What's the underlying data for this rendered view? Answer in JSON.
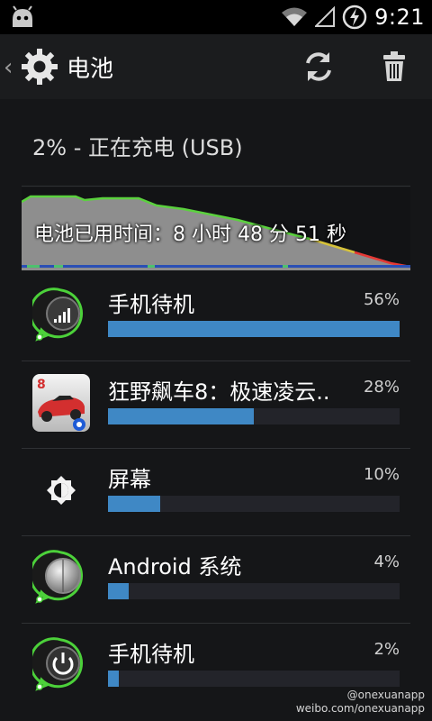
{
  "status_bar": {
    "time": "9:21"
  },
  "action_bar": {
    "back": "‹",
    "title": "电池"
  },
  "battery": {
    "status": "2% - 正在充电 (USB)",
    "graph_label": "电池已用时间：8 小时 48 分 51 秒"
  },
  "items": [
    {
      "name": "手机待机",
      "percent": "56%",
      "value": 56,
      "icon": "cell-standby-icon"
    },
    {
      "name": "狂野飙车8：极速凌云..",
      "percent": "28%",
      "value": 28,
      "icon": "racing-game-icon"
    },
    {
      "name": "屏幕",
      "percent": "10%",
      "value": 10,
      "icon": "brightness-icon"
    },
    {
      "name": "Android 系统",
      "percent": "4%",
      "value": 4,
      "icon": "android-system-icon"
    },
    {
      "name": "手机待机",
      "percent": "2%",
      "value": 2,
      "icon": "power-icon"
    }
  ],
  "watermark": {
    "line1": "@onexuanapp",
    "line2": "weibo.com/onexuanapp"
  },
  "colors": {
    "bar_fill": "#3f88c5",
    "bar_track": "#23242a",
    "graph_green": "#5bd13e",
    "graph_red": "#e53935",
    "graph_yellow": "#d6c23a"
  }
}
